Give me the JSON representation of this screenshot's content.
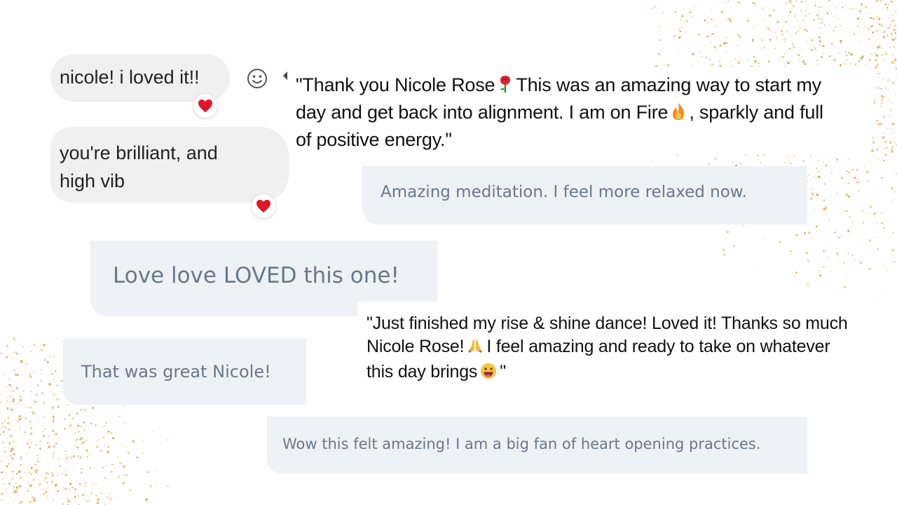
{
  "colors": {
    "card_background": "#eef1f5",
    "card_text": "#6a7889",
    "messenger_bubble": "#f0f0f0",
    "heart": "#e0162b",
    "glitter": "#c9a24a"
  },
  "messages": [
    {
      "text_line1": "nicole! i loved it!!",
      "reaction": "heart-icon"
    },
    {
      "text_line1": "you're brilliant, and",
      "text_line2": "high vib",
      "reaction": "heart-icon"
    }
  ],
  "quotes": [
    {
      "line1_before": "\"Thank you Nicole Rose",
      "line1_emoji": "rose-icon",
      "line1_after": "This was an amazing way to start my",
      "line2_before": "day and get back into alignment. I am on Fire",
      "line2_emoji": "fire-icon",
      "line2_after": ", sparkly and full",
      "line3": "of positive energy.\""
    },
    {
      "line1": "\"Just finished my rise & shine dance! Loved it! Thanks so much",
      "line2_before": "Nicole Rose!",
      "line2_emoji": "praying-hands-icon",
      "line2_after": "I feel amazing and ready to take on whatever",
      "line3_before": "this day brings",
      "line3_emoji": "grinning-face-icon",
      "line3_after": "\""
    }
  ],
  "cards": [
    "Amazing meditation. I feel more relaxed now.",
    "Love love LOVED this one!",
    "That was great Nicole!",
    "Wow this felt amazing! I am a big fan of heart opening practices."
  ]
}
